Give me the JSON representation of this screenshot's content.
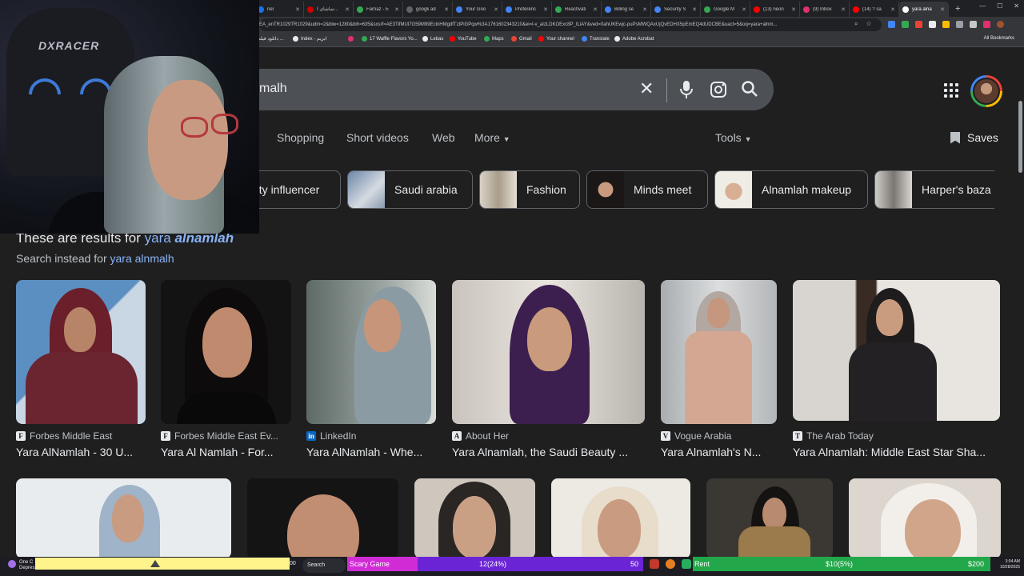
{
  "browser": {
    "tabs": [
      {
        "label": "nel",
        "color": "#1a73e8"
      },
      {
        "label": "تماشای آ...",
        "color": "#cc0000"
      },
      {
        "label": "Farnaz - E",
        "color": "#34a853"
      },
      {
        "label": "googk ad",
        "color": "#5f6368"
      },
      {
        "label": "Your Goo",
        "color": "#4285f4"
      },
      {
        "label": "Preferenc",
        "color": "#4285f4"
      },
      {
        "label": "Reactivati",
        "color": "#34a853"
      },
      {
        "label": "Billing se",
        "color": "#4285f4"
      },
      {
        "label": "Security S",
        "color": "#4285f4"
      },
      {
        "label": "Google M",
        "color": "#34a853"
      },
      {
        "label": "(13) neon",
        "color": "#ff0000"
      },
      {
        "label": "(9) Inbox",
        "color": "#e1306c"
      },
      {
        "label": "(14) ? sa",
        "color": "#ff0000"
      },
      {
        "label": "yara alna",
        "color": "#ffffff",
        "active": true
      }
    ],
    "new_tab": "+",
    "url": "EA_enTR1029TR1029&udm=2&biw=1280&bih=635&sxsrf=AE3TifMUl7G59M99EclnHMgdfTztPiGPqw%3A1761602343210&ei=l-v_aIzLDKOExc8P_tLiAY&ved=0ahUKEwjc-puPsMWQAxUjQvEDHX5pEmEQ4dUDCBE&uact=5&oq=yara+alnm...",
    "bookmarks": [
      {
        "label": "دانلود فیلم ..."
      },
      {
        "label": "Index - ابزیم"
      },
      {
        "label": ""
      },
      {
        "label": "17 Waffle Flavors Yo..."
      },
      {
        "label": "Lebas"
      },
      {
        "label": "YouTube"
      },
      {
        "label": "Maps"
      },
      {
        "label": "Gmail"
      },
      {
        "label": "Your channel"
      },
      {
        "label": "Translate"
      },
      {
        "label": "Adobe Acrobat"
      }
    ],
    "all_bookmarks": "All Bookmarks"
  },
  "google": {
    "query": "malh",
    "nav": [
      "Shopping",
      "Short videos",
      "Web",
      "More"
    ],
    "tools": "Tools",
    "saves": "Saves",
    "chips": [
      {
        "label": "uty influencer"
      },
      {
        "label": "Saudi arabia"
      },
      {
        "label": "Fashion"
      },
      {
        "label": "Minds meet"
      },
      {
        "label": "Alnamlah makeup"
      },
      {
        "label": "Harper's baza"
      }
    ],
    "results_prefix": "These are results for",
    "results_query_plain": "yara",
    "results_query_bold": "alnamlah",
    "instead_prefix": "Search instead for",
    "instead_query": "yara alnmalh",
    "images": [
      {
        "source": "Forbes Middle East",
        "icon": "F",
        "title": "Yara AlNamlah - 30 U..."
      },
      {
        "source": "Forbes Middle East Ev...",
        "icon": "F",
        "title": "Yara Al Namlah - For..."
      },
      {
        "source": "LinkedIn",
        "icon": "in",
        "title": "Yara AlNamlah - Whe..."
      },
      {
        "source": "About Her",
        "icon": "A",
        "title": "Yara Alnamlah, the Saudi Beauty ..."
      },
      {
        "source": "Vogue Arabia",
        "icon": "V",
        "title": "Yara Alnamlah's N..."
      },
      {
        "source": "The Arab Today",
        "icon": "T",
        "title": "Yara Alnamlah: Middle East Star Sha..."
      }
    ]
  },
  "webcam": {
    "chair_brand": "DXRACER"
  },
  "taskbar": {
    "weather_line1": "One C",
    "weather_line2": "Depress...",
    "counter_small": "00",
    "search": "Search",
    "pink_label": "Scary Game",
    "purple_value": "12(24%)",
    "purple_max": "50",
    "green_label": "Rent",
    "green_value": "$10(5%)",
    "green_max": "$200",
    "time": "3:04 AM",
    "date": "10/28/2025"
  }
}
